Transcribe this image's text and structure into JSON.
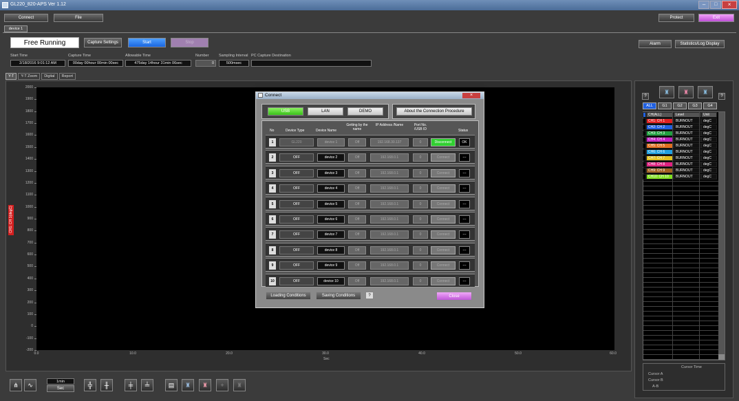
{
  "window": {
    "title": "GL220_820-APS Ver 1.12",
    "minimize": "–",
    "maximize": "□",
    "close": "×"
  },
  "toolbar": {
    "connect": "Connect",
    "file": "File",
    "protect": "Protect",
    "exit": "Exit"
  },
  "device_tab": "device 1",
  "status_label": "Free Running",
  "buttons": {
    "capture_settings": "Capture Settings",
    "start": "Start",
    "stop": "Stop",
    "alarm": "Alarm",
    "stats": "Statistics/Log Display"
  },
  "info": {
    "start_time_label": "Start Time",
    "start_time": "2/18/2016 9:01:12 AM",
    "capture_time_label": "Capture Time",
    "capture_time": "00day 00hour 00min 00sec",
    "allowable_time_label": "Allowable Time",
    "allowable_time": "475day 14hour 31min 06sec",
    "number_label": "Number",
    "number": "0",
    "interval_label": "Sampling Interval",
    "interval": "500msec",
    "dest_label": "PC Capture Destination",
    "dest": ""
  },
  "view_tabs": [
    "Y-T",
    "Y-T Zoom",
    "Digital",
    "Report"
  ],
  "plot": {
    "yticks": [
      "2000",
      "1900",
      "1800",
      "1700",
      "1600",
      "1500",
      "1400",
      "1300",
      "1200",
      "1100",
      "1000",
      "900",
      "800",
      "700",
      "600",
      "500",
      "400",
      "300",
      "200",
      "100",
      "0",
      "-100",
      "-200"
    ],
    "xticks": [
      "0.0",
      "10.0",
      "20.0",
      "30.0",
      "40.0",
      "50.0",
      "60.0"
    ],
    "xunit": "Sec",
    "ylabel": "CH1: CH 1(degC)"
  },
  "bottom": {
    "timebase": "1min",
    "unit": "Sec"
  },
  "dialog": {
    "title": "Connect",
    "tabs": {
      "usb": "USB",
      "lan": "LAN",
      "demo": "DEMO"
    },
    "about": "About the Connection Procedure",
    "headers": {
      "no": "No",
      "device_type": "Device Type",
      "device_name": "Device Name",
      "getting": "Getting by the name",
      "ip": "IP Address /Name",
      "port": "Port No. /USB ID",
      "status": "Status"
    },
    "rows": [
      {
        "no": "1",
        "type": "GL220",
        "name": "device 1",
        "get": "Off",
        "ip": "192.168.30.137",
        "port": "0",
        "action": "Disconnect",
        "status": "OK"
      },
      {
        "no": "2",
        "type": "OFF",
        "name": "device 2",
        "get": "Off",
        "ip": "192.168.0.1",
        "port": "0",
        "action": "Connect",
        "status": "---"
      },
      {
        "no": "3",
        "type": "OFF",
        "name": "device 3",
        "get": "Off",
        "ip": "192.168.0.1",
        "port": "0",
        "action": "Connect",
        "status": "---"
      },
      {
        "no": "4",
        "type": "OFF",
        "name": "device 4",
        "get": "Off",
        "ip": "192.168.0.1",
        "port": "0",
        "action": "Connect",
        "status": "---"
      },
      {
        "no": "5",
        "type": "OFF",
        "name": "device 5",
        "get": "Off",
        "ip": "192.168.0.1",
        "port": "0",
        "action": "Connect",
        "status": "---"
      },
      {
        "no": "6",
        "type": "OFF",
        "name": "device 6",
        "get": "Off",
        "ip": "192.168.0.1",
        "port": "0",
        "action": "Connect",
        "status": "---"
      },
      {
        "no": "7",
        "type": "OFF",
        "name": "device 7",
        "get": "Off",
        "ip": "192.168.0.1",
        "port": "0",
        "action": "Connect",
        "status": "---"
      },
      {
        "no": "8",
        "type": "OFF",
        "name": "device 8",
        "get": "Off",
        "ip": "192.168.0.1",
        "port": "0",
        "action": "Connect",
        "status": "---"
      },
      {
        "no": "9",
        "type": "OFF",
        "name": "device 9",
        "get": "Off",
        "ip": "192.168.0.1",
        "port": "0",
        "action": "Connect",
        "status": "---"
      },
      {
        "no": "10",
        "type": "OFF",
        "name": "device 10",
        "get": "Off",
        "ip": "192.168.0.1",
        "port": "0",
        "action": "Connect",
        "status": "---"
      }
    ],
    "loading": "Loading Conditions",
    "saving": "Saving Conditions",
    "help": "?",
    "close": "Close"
  },
  "right_panel": {
    "groups": [
      "ALL",
      "G1",
      "G2",
      "G3",
      "G4"
    ],
    "help": "?",
    "headers": [
      "CH(ALL)",
      "Level",
      "Unit"
    ],
    "channels": [
      {
        "ch": "CH1: CH 1",
        "level": "BURNOUT",
        "unit": "degC",
        "color": "#e02020"
      },
      {
        "ch": "CH2: CH 2",
        "level": "BURNOUT",
        "unit": "degC",
        "color": "#2060e0"
      },
      {
        "ch": "CH3: CH 3",
        "level": "BURNOUT",
        "unit": "degC",
        "color": "#20a040"
      },
      {
        "ch": "CH4: CH 4",
        "level": "BURNOUT",
        "unit": "degC",
        "color": "#c020c0"
      },
      {
        "ch": "CH5: CH 5",
        "level": "BURNOUT",
        "unit": "degC",
        "color": "#e07020"
      },
      {
        "ch": "CH6: CH 6",
        "level": "BURNOUT",
        "unit": "degC",
        "color": "#20a0e0"
      },
      {
        "ch": "CH7: CH 7",
        "level": "BURNOUT",
        "unit": "degC",
        "color": "#e0c020"
      },
      {
        "ch": "CH8: CH 8",
        "level": "BURNOUT",
        "unit": "degC",
        "color": "#e02080"
      },
      {
        "ch": "CH9: CH 9",
        "level": "BURNOUT",
        "unit": "degC",
        "color": "#a06020"
      },
      {
        "ch": "CH10: CH 10",
        "level": "BURNOUT",
        "unit": "degC",
        "color": "#80e020"
      }
    ],
    "cursor": {
      "header": "Cursor Time",
      "a": "Cursor A",
      "b": "Cursor B",
      "ab": "A-B"
    }
  }
}
